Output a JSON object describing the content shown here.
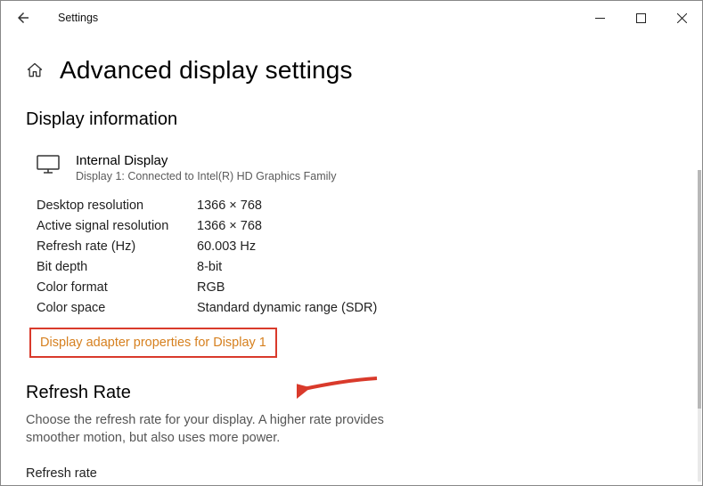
{
  "window": {
    "title": "Settings"
  },
  "header": {
    "page_title": "Advanced display settings"
  },
  "display_info": {
    "section_title": "Display information",
    "name": "Internal Display",
    "subtitle": "Display 1: Connected to Intel(R) HD Graphics Family",
    "rows": {
      "desktop_res_label": "Desktop resolution",
      "desktop_res_value": "1366 × 768",
      "signal_res_label": "Active signal resolution",
      "signal_res_value": "1366 × 768",
      "refresh_label": "Refresh rate (Hz)",
      "refresh_value": "60.003 Hz",
      "bitdepth_label": "Bit depth",
      "bitdepth_value": "8-bit",
      "colorfmt_label": "Color format",
      "colorfmt_value": "RGB",
      "colorspace_label": "Color space",
      "colorspace_value": "Standard dynamic range (SDR)"
    },
    "adapter_link": "Display adapter properties for Display 1"
  },
  "refresh_rate": {
    "section_title": "Refresh Rate",
    "description": "Choose the refresh rate for your display. A higher rate provides smoother motion, but also uses more power.",
    "field_label": "Refresh rate"
  },
  "annotation": {
    "highlight_color": "#d93a2b",
    "link_color": "#d6801f"
  }
}
